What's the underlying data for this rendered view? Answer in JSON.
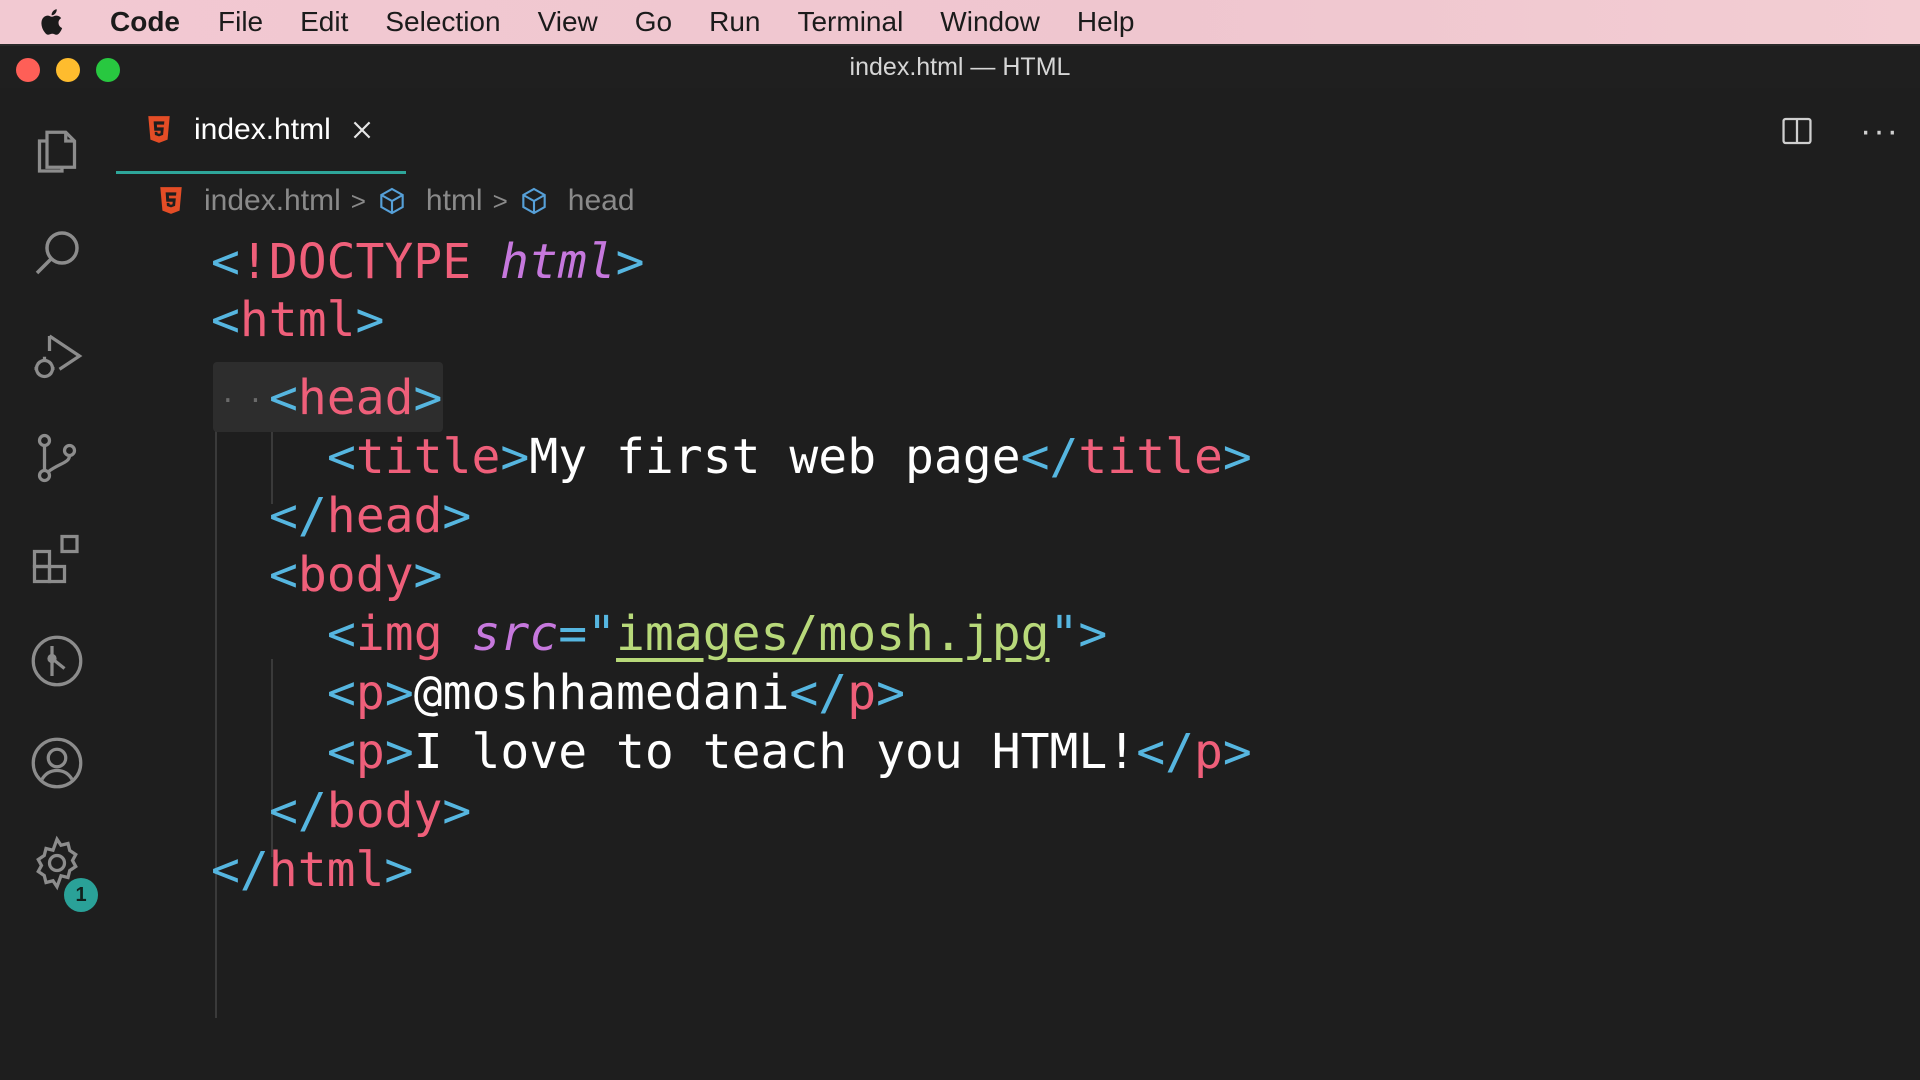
{
  "menubar": {
    "app_name": "Code",
    "items": [
      "File",
      "Edit",
      "Selection",
      "View",
      "Go",
      "Run",
      "Terminal",
      "Window",
      "Help"
    ]
  },
  "window": {
    "title": "index.html — HTML"
  },
  "activity_bar": {
    "items": [
      "explorer-icon",
      "search-icon",
      "run-debug-icon",
      "source-control-icon",
      "extensions-icon",
      "git-graph-icon",
      "account-icon",
      "settings-gear-icon"
    ],
    "settings_badge": "1"
  },
  "tab": {
    "label": "index.html"
  },
  "breadcrumb": {
    "file": "index.html",
    "items": [
      "html",
      "head"
    ]
  },
  "code": {
    "doctype_open": "<!",
    "doctype_kw": "DOCTYPE",
    "doctype_html": "html",
    "title_text": "My first web page",
    "img_src": "images/mosh.jpg",
    "p1_text": "@moshhamedani",
    "p2_text": "I love to teach you HTML!"
  },
  "colors": {
    "punctuation": "#56b6e0",
    "tag": "#ef5f7a",
    "attribute": "#c678dd",
    "string": "#b8d97a",
    "accent": "#2ea69a"
  }
}
